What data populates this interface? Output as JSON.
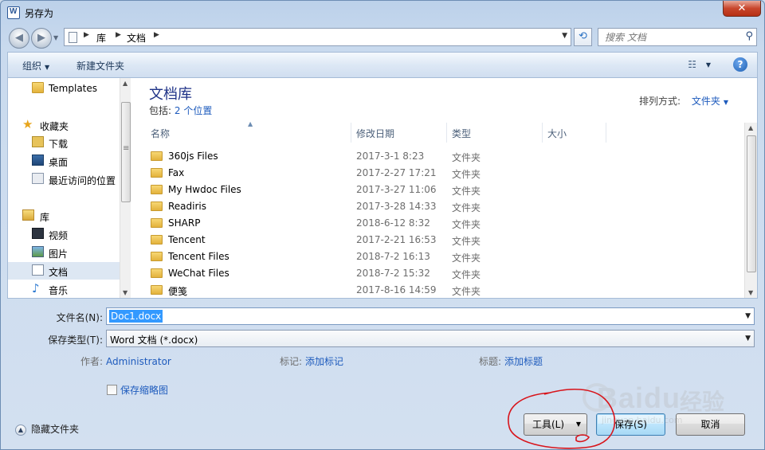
{
  "window": {
    "title": "另存为",
    "close_label": "✕"
  },
  "address": {
    "crumbs": [
      "库",
      "文档"
    ],
    "search_placeholder": "搜索 文档"
  },
  "toolbar": {
    "organize_label": "组织",
    "new_folder_label": "新建文件夹",
    "help_label": "?"
  },
  "navpane": {
    "items": [
      {
        "label": "Templates",
        "icon": "folder-icon"
      },
      {
        "label": "收藏夹",
        "icon": "star-icon"
      },
      {
        "label": "下载",
        "icon": "download-folder-icon"
      },
      {
        "label": "桌面",
        "icon": "desktop-icon"
      },
      {
        "label": "最近访问的位置",
        "icon": "recent-places-icon"
      },
      {
        "label": "库",
        "icon": "library-icon"
      },
      {
        "label": "视频",
        "icon": "video-icon"
      },
      {
        "label": "图片",
        "icon": "pictures-icon"
      },
      {
        "label": "文档",
        "icon": "documents-icon"
      },
      {
        "label": "音乐",
        "icon": "music-icon"
      }
    ],
    "selected": "文档"
  },
  "library": {
    "title": "文档库",
    "includes_prefix": "包括:",
    "includes_link": "2 个位置",
    "arrange_label": "排列方式:",
    "arrange_value": "文件夹"
  },
  "columns": {
    "name": "名称",
    "date": "修改日期",
    "type": "类型",
    "size": "大小"
  },
  "files": [
    {
      "name": "360js Files",
      "date": "2017-3-1 8:23",
      "type": "文件夹"
    },
    {
      "name": "Fax",
      "date": "2017-2-27 17:21",
      "type": "文件夹"
    },
    {
      "name": "My Hwdoc Files",
      "date": "2017-3-27 11:06",
      "type": "文件夹"
    },
    {
      "name": "Readiris",
      "date": "2017-3-28 14:33",
      "type": "文件夹"
    },
    {
      "name": "SHARP",
      "date": "2018-6-12 8:32",
      "type": "文件夹"
    },
    {
      "name": "Tencent",
      "date": "2017-2-21 16:53",
      "type": "文件夹"
    },
    {
      "name": "Tencent Files",
      "date": "2018-7-2 16:13",
      "type": "文件夹"
    },
    {
      "name": "WeChat Files",
      "date": "2018-7-2 15:32",
      "type": "文件夹"
    },
    {
      "name": "便笺",
      "date": "2017-8-16 14:59",
      "type": "文件夹"
    }
  ],
  "form": {
    "filename_label": "文件名(N):",
    "filename_value": "Doc1.docx",
    "filetype_label": "保存类型(T):",
    "filetype_value": "Word 文档 (*.docx)",
    "author_label": "作者:",
    "author_value": "Administrator",
    "tags_label": "标记:",
    "tags_value": "添加标记",
    "title_label": "标题:",
    "title_value": "添加标题",
    "thumbnail_label": "保存缩略图"
  },
  "footer": {
    "hide_folders_label": "隐藏文件夹",
    "tools_label": "工具(L)",
    "save_label": "保存(S)",
    "cancel_label": "取消"
  },
  "watermark": {
    "brand": "Baidu",
    "brand_cn": "经验",
    "url": "jingyan.baidu.com"
  },
  "colors": {
    "link": "#1e5bbd",
    "title_blue": "#1e3287",
    "annotation_red": "#d8141b"
  }
}
